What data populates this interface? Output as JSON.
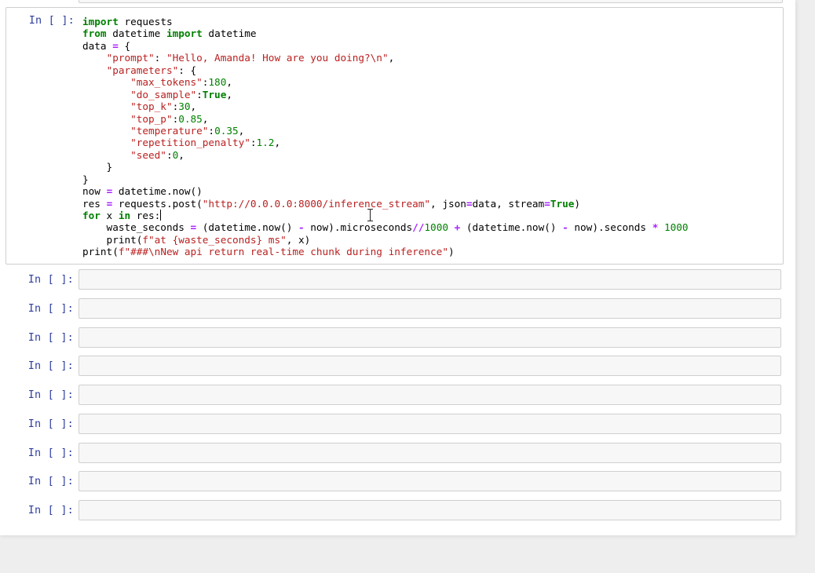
{
  "prompt_label": "In [ ]:",
  "active_cell": {
    "prompt": "In [ ]:",
    "lines": [
      [
        [
          "kw",
          "import"
        ],
        [
          "t",
          " requests"
        ]
      ],
      [
        [
          "kw",
          "from"
        ],
        [
          "t",
          " datetime "
        ],
        [
          "kw",
          "import"
        ],
        [
          "t",
          " datetime"
        ]
      ],
      [
        [
          "t",
          "data "
        ],
        [
          "op",
          "="
        ],
        [
          "t",
          " {"
        ]
      ],
      [
        [
          "t",
          "    "
        ],
        [
          "str",
          "\"prompt\""
        ],
        [
          "t",
          ": "
        ],
        [
          "str",
          "\"Hello, Amanda! How are you doing?\\n\""
        ],
        [
          "t",
          ","
        ]
      ],
      [
        [
          "t",
          "    "
        ],
        [
          "str",
          "\"parameters\""
        ],
        [
          "t",
          ": {"
        ]
      ],
      [
        [
          "t",
          "        "
        ],
        [
          "str",
          "\"max_tokens\""
        ],
        [
          "t",
          ":"
        ],
        [
          "num",
          "180"
        ],
        [
          "t",
          ","
        ]
      ],
      [
        [
          "t",
          "        "
        ],
        [
          "str",
          "\"do_sample\""
        ],
        [
          "t",
          ":"
        ],
        [
          "kw",
          "True"
        ],
        [
          "t",
          ","
        ]
      ],
      [
        [
          "t",
          "        "
        ],
        [
          "str",
          "\"top_k\""
        ],
        [
          "t",
          ":"
        ],
        [
          "num",
          "30"
        ],
        [
          "t",
          ","
        ]
      ],
      [
        [
          "t",
          "        "
        ],
        [
          "str",
          "\"top_p\""
        ],
        [
          "t",
          ":"
        ],
        [
          "num",
          "0.85"
        ],
        [
          "t",
          ","
        ]
      ],
      [
        [
          "t",
          "        "
        ],
        [
          "str",
          "\"temperature\""
        ],
        [
          "t",
          ":"
        ],
        [
          "num",
          "0.35"
        ],
        [
          "t",
          ","
        ]
      ],
      [
        [
          "t",
          "        "
        ],
        [
          "str",
          "\"repetition_penalty\""
        ],
        [
          "t",
          ":"
        ],
        [
          "num",
          "1.2"
        ],
        [
          "t",
          ","
        ]
      ],
      [
        [
          "t",
          "        "
        ],
        [
          "str",
          "\"seed\""
        ],
        [
          "t",
          ":"
        ],
        [
          "num",
          "0"
        ],
        [
          "t",
          ","
        ]
      ],
      [
        [
          "t",
          "    }"
        ]
      ],
      [
        [
          "t",
          "}"
        ]
      ],
      [
        [
          "t",
          "now "
        ],
        [
          "op",
          "="
        ],
        [
          "t",
          " datetime.now()"
        ]
      ],
      [
        [
          "t",
          "res "
        ],
        [
          "op",
          "="
        ],
        [
          "t",
          " requests.post("
        ],
        [
          "str",
          "\"http://0.0.0.0:8000/inference_stream\""
        ],
        [
          "t",
          ", json"
        ],
        [
          "op",
          "="
        ],
        [
          "t",
          "data, stream"
        ],
        [
          "op",
          "="
        ],
        [
          "kw",
          "True"
        ],
        [
          "t",
          ")"
        ]
      ],
      [
        [
          "kw",
          "for"
        ],
        [
          "t",
          " x "
        ],
        [
          "kw",
          "in"
        ],
        [
          "t",
          " res:"
        ],
        [
          "cursor",
          ""
        ]
      ],
      [
        [
          "t",
          "    waste_seconds "
        ],
        [
          "op",
          "="
        ],
        [
          "t",
          " (datetime.now() "
        ],
        [
          "op",
          "-"
        ],
        [
          "t",
          " now).microseconds"
        ],
        [
          "op",
          "//"
        ],
        [
          "num",
          "1000"
        ],
        [
          "t",
          " "
        ],
        [
          "op",
          "+"
        ],
        [
          "t",
          " (datetime.now() "
        ],
        [
          "op",
          "-"
        ],
        [
          "t",
          " now).seconds "
        ],
        [
          "op",
          "*"
        ],
        [
          "t",
          " "
        ],
        [
          "num",
          "1000"
        ]
      ],
      [
        [
          "t",
          "    print("
        ],
        [
          "str",
          "f\"at {waste_seconds} ms\""
        ],
        [
          "t",
          ", x)"
        ]
      ],
      [
        [
          "t",
          "print("
        ],
        [
          "str",
          "f\"###\\nNew api return real-time chunk during inference\""
        ],
        [
          "t",
          ")"
        ]
      ]
    ]
  },
  "empty_cells": [
    {
      "prompt": "In [ ]:"
    },
    {
      "prompt": "In [ ]:"
    },
    {
      "prompt": "In [ ]:"
    },
    {
      "prompt": "In [ ]:"
    },
    {
      "prompt": "In [ ]:"
    },
    {
      "prompt": "In [ ]:"
    },
    {
      "prompt": "In [ ]:"
    },
    {
      "prompt": "In [ ]:"
    },
    {
      "prompt": "In [ ]:"
    }
  ],
  "colors": {
    "keyword": "#008000",
    "string": "#ba2121",
    "number": "#008000",
    "operator": "#aa22ff",
    "prompt": "#303f9f",
    "editor_bg": "#f7f7f7",
    "border": "#cfcfcf"
  },
  "icons": {
    "mouse_cursor": "text-cursor-ibeam-icon"
  }
}
